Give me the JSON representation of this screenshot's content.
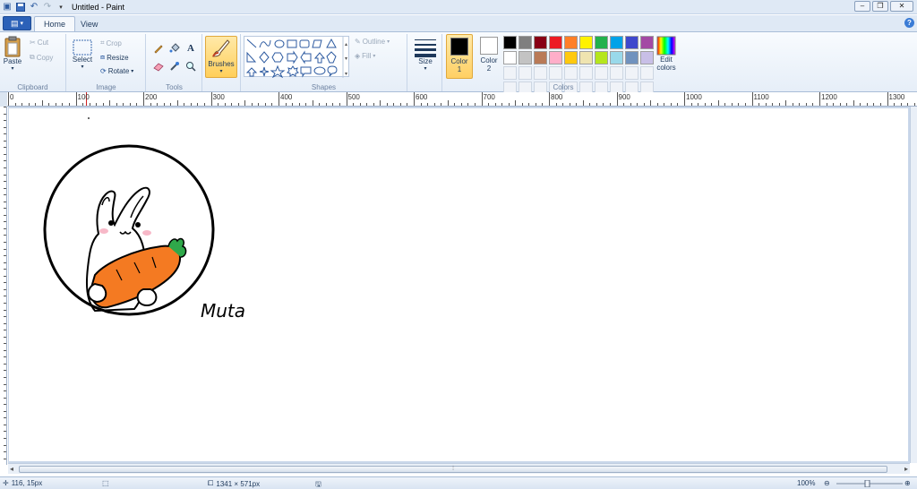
{
  "window": {
    "title": "Untitled - Paint"
  },
  "tabs": {
    "home": "Home",
    "view": "View"
  },
  "ribbon": {
    "clipboard": {
      "label": "Clipboard",
      "paste": "Paste",
      "cut": "Cut",
      "copy": "Copy"
    },
    "image": {
      "label": "Image",
      "select": "Select",
      "crop": "Crop",
      "resize": "Resize",
      "rotate": "Rotate"
    },
    "tools": {
      "label": "Tools"
    },
    "brushes": "Brushes",
    "shapes": {
      "label": "Shapes",
      "outline": "Outline",
      "fill": "Fill"
    },
    "size": "Size",
    "colors": {
      "label": "Colors",
      "color1_label": "Color",
      "color1_num": "1",
      "color2_label": "Color",
      "color2_num": "2",
      "edit_label": "Edit",
      "edit_label2": "colors",
      "color1": "#000000",
      "color2": "#ffffff",
      "palette": [
        "#000000",
        "#7f7f7f",
        "#880015",
        "#ed1c24",
        "#ff7f27",
        "#fff200",
        "#22b14c",
        "#00a2e8",
        "#3f48cc",
        "#a349a4",
        "#ffffff",
        "#c3c3c3",
        "#b97a57",
        "#ffaec9",
        "#ffc90e",
        "#efe4b0",
        "#b5e61d",
        "#99d9ea",
        "#7092be",
        "#c8bfe7",
        "",
        "",
        "",
        "",
        "",
        "",
        "",
        "",
        "",
        "",
        "",
        "",
        "",
        "",
        "",
        "",
        "",
        "",
        "",
        ""
      ]
    }
  },
  "ruler": {
    "labels": [
      "0",
      "100",
      "200",
      "300",
      "400",
      "500",
      "600",
      "700",
      "800",
      "900",
      "1000",
      "1100",
      "1200",
      "1300"
    ]
  },
  "canvas": {
    "signature": "Muta"
  },
  "status": {
    "cursor": "116, 15px",
    "size": "1341 × 571px",
    "zoom": "100%"
  }
}
